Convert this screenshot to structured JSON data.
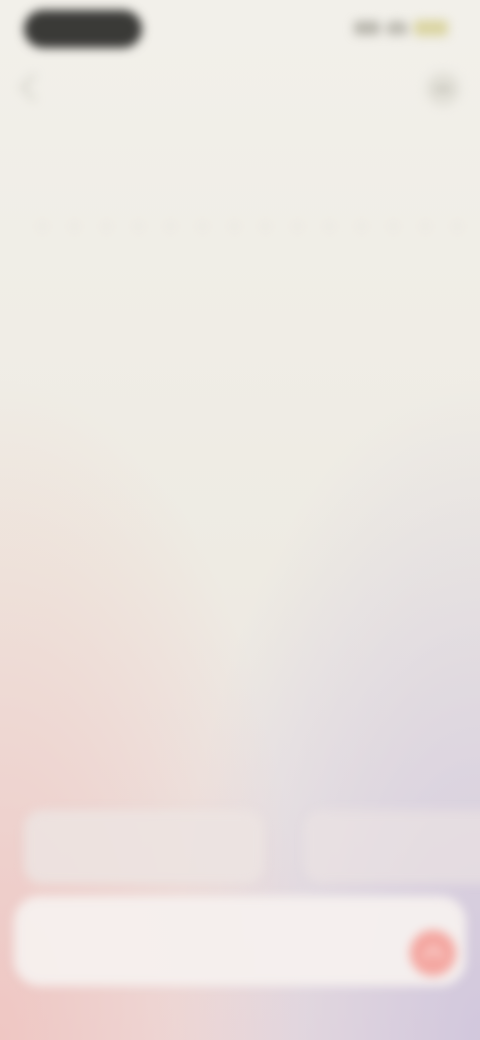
{
  "status_bar": {
    "time": ""
  },
  "header": {
    "title": ""
  },
  "suggestions": [
    {
      "line1": "",
      "line2": ""
    },
    {
      "line1": "",
      "line2": ""
    }
  ],
  "composer": {
    "text_line1": "",
    "text_line2": ""
  },
  "colors": {
    "background": "#f2f0ea",
    "accent": "#f4a7a1",
    "pill": "#262624"
  },
  "icons": {
    "back": "back-arrow-icon",
    "menu": "menu-icon",
    "send": "send-arrow-icon"
  }
}
